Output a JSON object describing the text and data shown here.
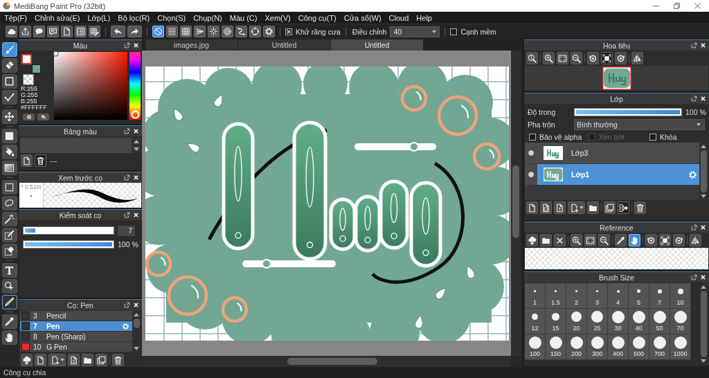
{
  "window": {
    "title": "MediBang Paint Pro (32bit)"
  },
  "menu": [
    "Tệp(F)",
    "Chỉnh sửa(E)",
    "Lớp(L)",
    "Bộ lọc(R)",
    "Chọn(S)",
    "Chụp(N)",
    "Màu (C)",
    "Xem(V)",
    "Công cụ(T)",
    "Cửa sổ(W)",
    "Cloud",
    "Help"
  ],
  "toolbar": {
    "file_buttons": [
      {
        "kind": "cloud"
      },
      {
        "kind": "upload"
      },
      {
        "kind": "comment"
      },
      {
        "kind": "chat"
      },
      {
        "kind": "page"
      },
      {
        "kind": "list"
      },
      {
        "kind": "table-edit"
      }
    ],
    "history_buttons": [
      {
        "kind": "undo"
      },
      {
        "kind": "redo"
      }
    ],
    "snap_buttons": [
      {
        "kind": "snap-off",
        "selected": true
      },
      {
        "kind": "parallel",
        "selected": false
      },
      {
        "kind": "grid",
        "selected": false
      },
      {
        "kind": "perspective",
        "selected": false
      },
      {
        "kind": "radial",
        "selected": false
      },
      {
        "kind": "concentric",
        "selected": false
      },
      {
        "kind": "curve",
        "selected": false
      },
      {
        "kind": "ellipse",
        "selected": false
      }
    ],
    "antialias": {
      "label": "Khử răng cưa",
      "checked": true
    },
    "correction": {
      "label": "Điều chỉnh",
      "value": "40"
    },
    "soft_edge": {
      "label": "Cạnh mềm",
      "checked": false
    }
  },
  "tool_groups": [
    [
      {
        "kind": "brush",
        "selected": true,
        "hovered": false
      },
      {
        "kind": "eraser",
        "selected": false,
        "hovered": false
      },
      {
        "kind": "square",
        "selected": false,
        "hovered": false
      },
      {
        "kind": "polyline",
        "selected": false,
        "hovered": false
      }
    ],
    [
      {
        "kind": "move",
        "selected": false,
        "hovered": false
      }
    ],
    [
      {
        "kind": "fill",
        "selected": false,
        "hovered": false
      },
      {
        "kind": "bucket",
        "selected": false,
        "hovered": false
      },
      {
        "kind": "gradient",
        "selected": false,
        "hovered": false
      }
    ],
    [
      {
        "kind": "rect-select",
        "selected": false,
        "hovered": false
      },
      {
        "kind": "lasso",
        "selected": false,
        "hovered": false
      },
      {
        "kind": "wand",
        "selected": false,
        "hovered": false
      },
      {
        "kind": "select-pen",
        "selected": false,
        "hovered": false
      },
      {
        "kind": "select-eraser",
        "selected": false,
        "hovered": false
      }
    ],
    [
      {
        "kind": "text",
        "selected": false,
        "hovered": false
      },
      {
        "kind": "operation",
        "selected": false,
        "hovered": false
      },
      {
        "kind": "divide",
        "selected": false,
        "hovered": true
      }
    ],
    [
      {
        "kind": "eyedropper",
        "selected": false,
        "hovered": false
      },
      {
        "kind": "hand",
        "selected": false,
        "hovered": false
      }
    ]
  ],
  "left_panels": [
    {
      "kind": "color",
      "title": "Màu",
      "foreground": {
        "color": "#ffffff",
        "selected": true
      },
      "background": {
        "color": "#6fa793",
        "selected": false
      },
      "readout": [
        "R:255",
        "G:255",
        "B:255",
        "#FFFFFF"
      ]
    },
    {
      "kind": "palette",
      "title": "Bảng màu",
      "tools": [
        [
          {
            "kind": "page",
            "pressed": false
          },
          {
            "kind": "trash",
            "pressed": true
          }
        ]
      ],
      "label": "---"
    },
    {
      "kind": "preview",
      "title": "Xem trước cọ",
      "size_label": "* 0.51m"
    },
    {
      "kind": "control",
      "title": "Kiểm soát cọ",
      "sliders": [
        {
          "kind": "size",
          "level": 0.12,
          "reading": "7"
        },
        {
          "kind": "opacity",
          "level": 1,
          "reading": "100 %"
        }
      ]
    },
    {
      "kind": "brushes",
      "title": "Cọ: Pen",
      "brushes": [
        {
          "number": "3",
          "name": "Pencil",
          "color": "#333333",
          "selected": false
        },
        {
          "number": "7",
          "name": "Pen",
          "color": "#333333",
          "selected": true
        },
        {
          "number": "8",
          "name": "Pen (Sharp)",
          "color": "#333333",
          "selected": false
        },
        {
          "number": "10",
          "name": "G Pen",
          "color": "#ee2b2b",
          "selected": false
        }
      ],
      "tools": [
        [
          {
            "kind": "cloud-download"
          },
          {
            "kind": "page"
          },
          {
            "kind": "page-add"
          },
          {
            "kind": "page-s"
          },
          {
            "kind": "folder"
          },
          {
            "kind": "copy"
          }
        ],
        [
          {
            "kind": "trash"
          }
        ]
      ]
    }
  ],
  "canvas": {
    "tabs": [
      {
        "label": "images.jpg",
        "selected": false
      },
      {
        "label": "Untitled",
        "selected": false
      },
      {
        "label": "Untitled",
        "selected": true
      }
    ]
  },
  "right_panels": [
    {
      "kind": "navigator",
      "title": "Hoa tiêu",
      "tools": [
        [
          {
            "kind": "zoom-reset",
            "pressed": false
          }
        ],
        [
          {
            "kind": "zoom-in",
            "pressed": false
          },
          {
            "kind": "fit",
            "pressed": false
          },
          {
            "kind": "zoom-out",
            "pressed": false
          }
        ],
        [
          {
            "kind": "rotate-left",
            "pressed": false
          },
          {
            "kind": "fit-window",
            "pressed": true
          },
          {
            "kind": "rotate-right",
            "pressed": false
          }
        ],
        [
          {
            "kind": "flip",
            "pressed": false
          }
        ]
      ]
    },
    {
      "kind": "layers",
      "title": "Lớp",
      "opacity": {
        "label": "Độ trong",
        "level": 1,
        "reading": "100 %"
      },
      "blend": {
        "label": "Pha trộn",
        "value": "Bình thường"
      },
      "options": [
        {
          "label": "Bảo vệ alpha",
          "checked": false,
          "disabled": false
        },
        {
          "label": "Xén bớt",
          "checked": false,
          "disabled": true
        },
        {
          "label": "Khóa",
          "checked": false,
          "disabled": false
        }
      ],
      "layers": [
        {
          "name": "Lớp3",
          "selected": false,
          "visible": true
        },
        {
          "name": "Lớp1",
          "selected": true,
          "visible": true
        }
      ],
      "tools": [
        [
          {
            "kind": "page",
            "pressed": false
          },
          {
            "kind": "page-square",
            "pressed": false
          },
          {
            "kind": "page-arrow",
            "pressed": false
          },
          {
            "kind": "page-add",
            "pressed": false
          },
          {
            "kind": "folder",
            "pressed": false
          }
        ],
        [
          {
            "kind": "copy",
            "pressed": false
          },
          {
            "kind": "merge",
            "pressed": true
          }
        ],
        [
          {
            "kind": "trash",
            "pressed": false
          }
        ]
      ]
    },
    {
      "kind": "reference",
      "title": "Reference",
      "tools": [
        [
          {
            "kind": "cloud-download",
            "selected": false
          },
          {
            "kind": "folder",
            "selected": false
          },
          {
            "kind": "close",
            "selected": false
          }
        ],
        [
          {
            "kind": "zoom-in",
            "selected": false
          },
          {
            "kind": "fit",
            "selected": false
          },
          {
            "kind": "zoom-out",
            "selected": false
          }
        ],
        [
          {
            "kind": "eyedropper",
            "selected": false
          },
          {
            "kind": "hand",
            "selected": true
          }
        ],
        [
          {
            "kind": "rotate-left",
            "selected": false
          },
          {
            "kind": "fit-window",
            "selected": false
          },
          {
            "kind": "rotate-right",
            "selected": false
          }
        ],
        [
          {
            "kind": "flip",
            "selected": false
          }
        ]
      ]
    },
    {
      "kind": "brushsize",
      "title": "Brush Size",
      "sizes": [
        "1",
        "1.5",
        "2",
        "3",
        "4",
        "5",
        "7",
        "10",
        "12",
        "15",
        "20",
        "25",
        "30",
        "40",
        "50",
        "70",
        "100",
        "150",
        "200",
        "300",
        "400",
        "500",
        "700",
        "1000"
      ]
    }
  ],
  "status_bar": {
    "text": "Công cụ chia"
  }
}
